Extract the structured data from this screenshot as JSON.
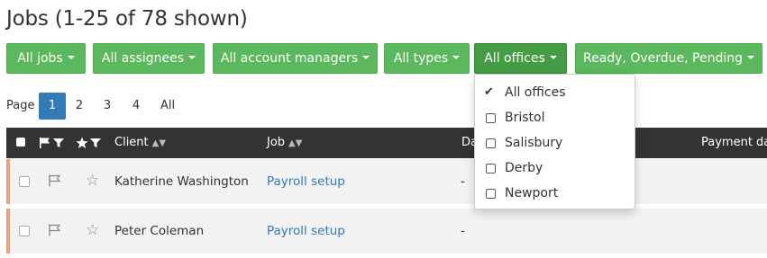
{
  "page_title": "Jobs (1-25 of 78 shown)",
  "filters": [
    {
      "label": "All jobs"
    },
    {
      "label": "All assignees"
    },
    {
      "label": "All account managers"
    },
    {
      "label": "All types"
    },
    {
      "label": "All offices",
      "active": true
    },
    {
      "label": "Ready, Overdue, Pending"
    }
  ],
  "pagination": {
    "label": "Page",
    "pages": [
      "1",
      "2",
      "3",
      "4",
      "All"
    ],
    "current": "1"
  },
  "table": {
    "headers": {
      "client": "Client",
      "job": "Job",
      "date_partial": "Da",
      "payment_partial": "Payment da"
    },
    "rows": [
      {
        "client": "Katherine Washington",
        "job": "Payroll setup",
        "date": "-"
      },
      {
        "client": "Peter Coleman",
        "job": "Payroll setup",
        "date": "-"
      }
    ]
  },
  "offices_dropdown": {
    "items": [
      {
        "label": "All offices",
        "checked": true
      },
      {
        "label": "Bristol",
        "checked": false
      },
      {
        "label": "Salisbury",
        "checked": false
      },
      {
        "label": "Derby",
        "checked": false
      },
      {
        "label": "Newport",
        "checked": false
      }
    ]
  },
  "colors": {
    "filter_button": "#5cb85c",
    "filter_button_active": "#449d44",
    "header_bg": "#333333",
    "row_accent": "#f0a07c",
    "link": "#337ab7",
    "current_page": "#337ab7"
  }
}
